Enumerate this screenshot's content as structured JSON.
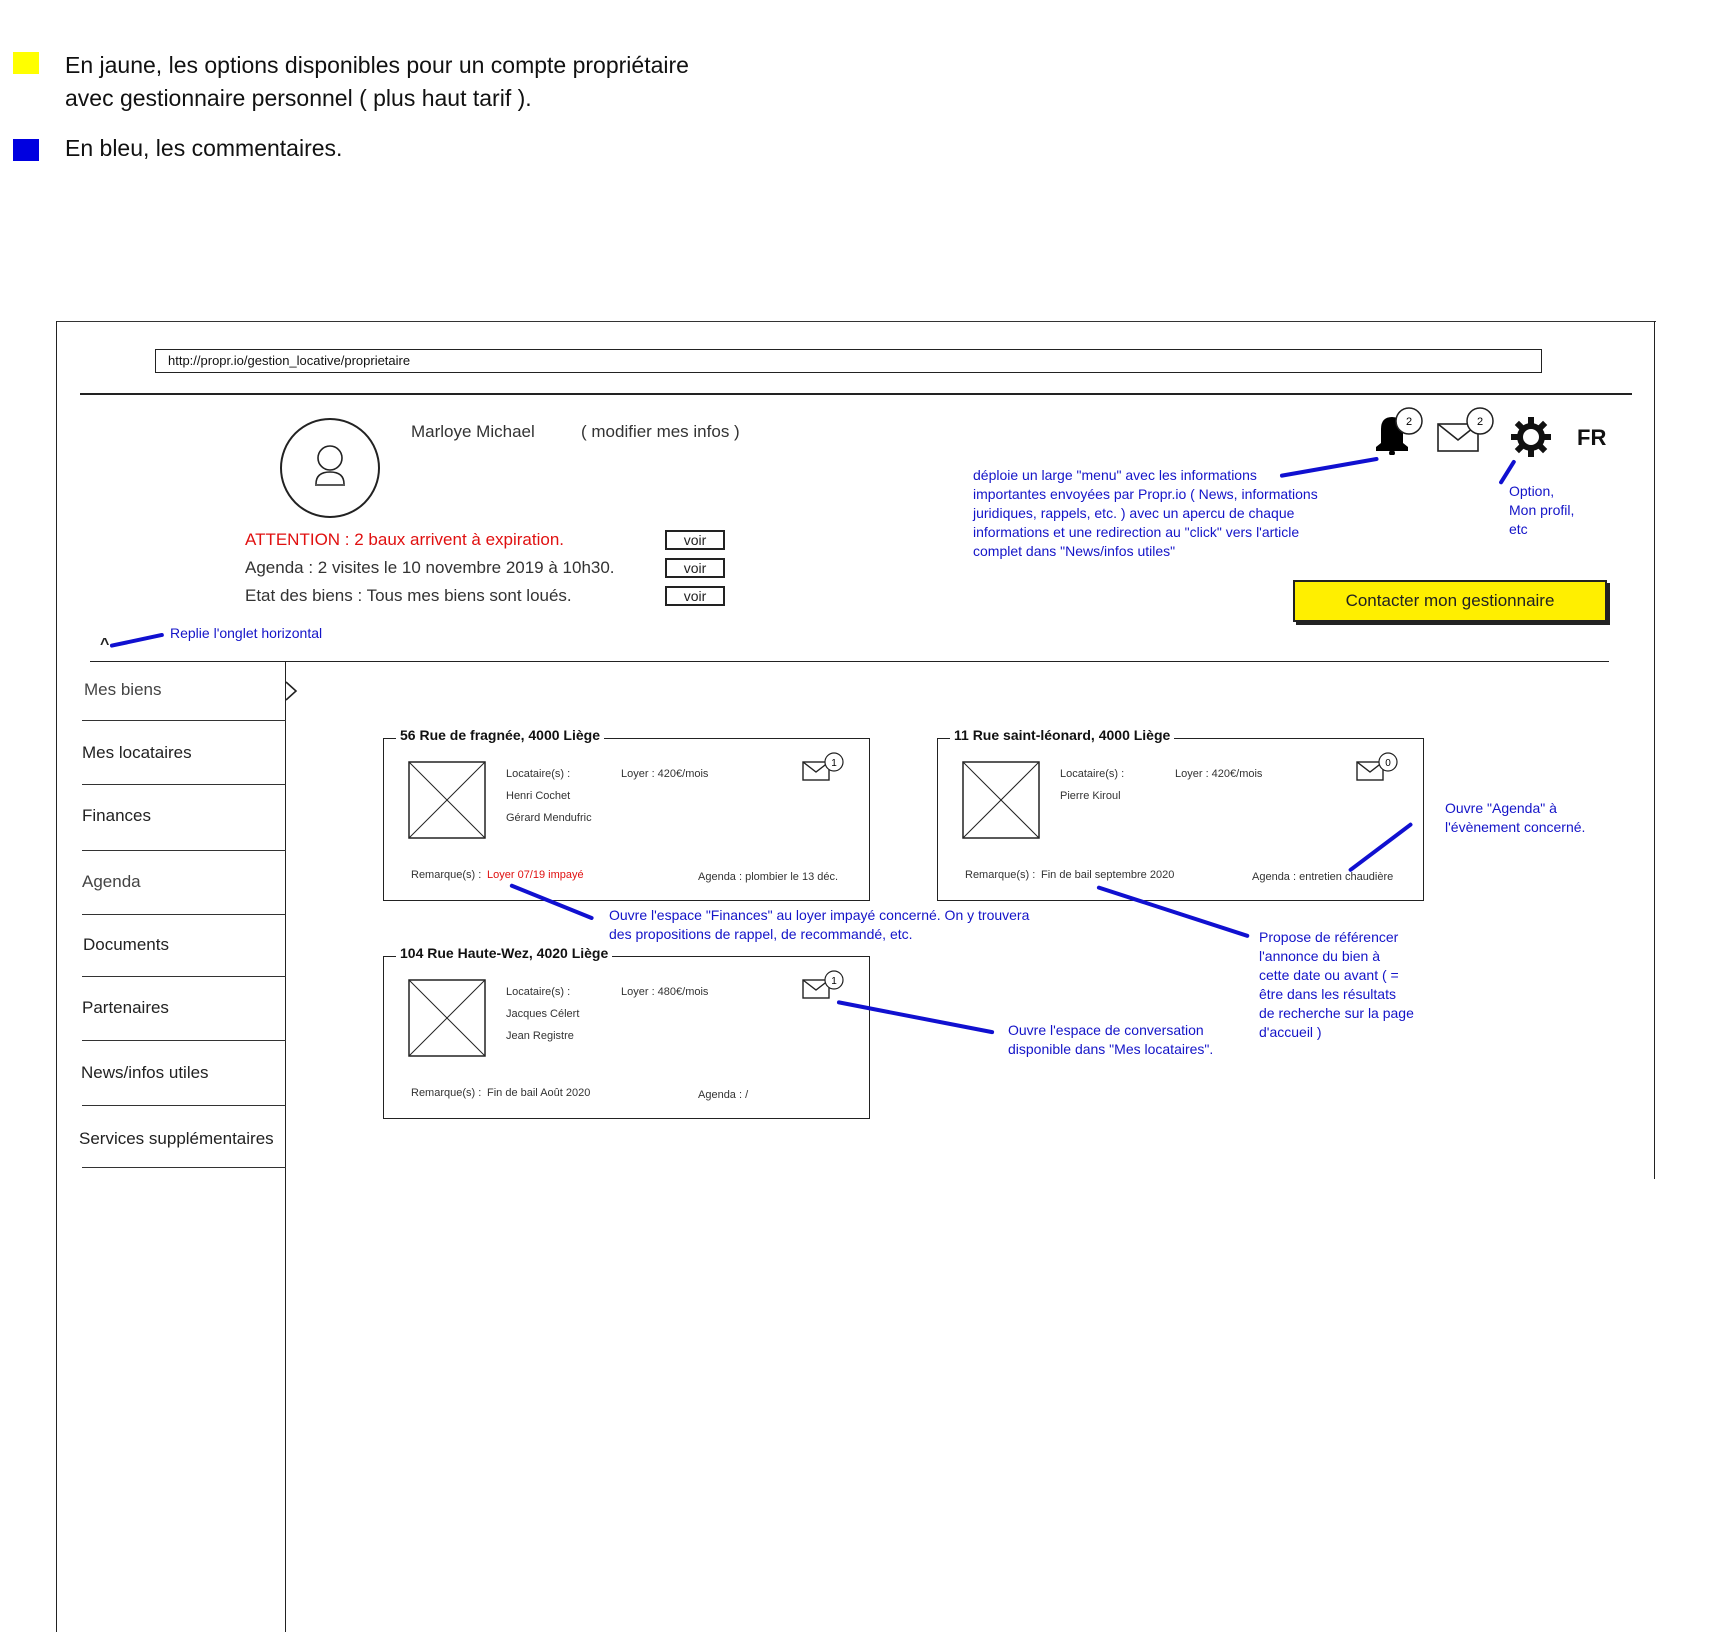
{
  "legend": {
    "yellow_color": "#ffff00",
    "blue_color": "#0000e0",
    "yellow_line1": "En jaune, les options disponibles pour un compte propriétaire",
    "yellow_line2": "avec gestionnaire personnel ( plus haut tarif ).",
    "blue_text": "En bleu, les commentaires."
  },
  "browser": {
    "url_prefix": "http://propr.io/",
    "url_path": "gestion_locative/proprietaire"
  },
  "profile": {
    "name": "Marloye Michael",
    "edit_link": "( modifier mes infos )"
  },
  "alerts": [
    {
      "text": "ATTENTION : 2 baux arrivent à expiration.",
      "button": "voir"
    },
    {
      "text": "Agenda : 2 visites le 10 novembre 2019 à 10h30.",
      "button": "voir"
    },
    {
      "text": "Etat des biens : Tous mes biens sont loués.",
      "button": "voir"
    }
  ],
  "header": {
    "notifications_count": "2",
    "messages_count": "2",
    "language": "FR",
    "contact_button": "Contacter mon gestionnaire"
  },
  "annotations": {
    "notifications": [
      "déploie un large \"menu\" avec les informations",
      "importantes envoyées par Propr.io ( News, informations",
      "juridiques, rappels, etc. ) avec un apercu de chaque",
      "informations et une redirection au \"click\" vers l'article",
      "complet dans \"News/infos utiles\""
    ],
    "settings": [
      "Option,",
      "Mon profil,",
      "etc"
    ],
    "collapse": "Replie l'onglet horizontal",
    "collapse_symbol": "^",
    "agenda": [
      "Ouvre \"Agenda\" à",
      "l'évènement concerné."
    ],
    "finances": [
      "Ouvre l'espace \"Finances\" au loyer impayé concerné. On y trouvera",
      "des propositions de rappel, de recommandé, etc."
    ],
    "listing": [
      "Propose de référencer",
      "l'annonce du bien à",
      "cette date ou avant ( =",
      "être dans les résultats",
      "de recherche sur la page",
      "d'accueil )"
    ],
    "conversation": [
      "Ouvre l'espace de conversation",
      "disponible dans \"Mes locataires\"."
    ]
  },
  "sidebar": {
    "items": [
      "Mes biens",
      "Mes locataires",
      "Finances",
      "Agenda",
      "Documents",
      "Partenaires",
      "News/infos utiles",
      "Services supplémentaires"
    ]
  },
  "properties": [
    {
      "address": "56 Rue de fragnée, 4000 Liège",
      "tenants_label": "Locataire(s) :",
      "tenants": [
        "Henri Cochet",
        "Gérard Mendufric"
      ],
      "rent": "Loyer : 420€/mois",
      "messages": "1",
      "remark_label": "Remarque(s) :",
      "remark": "Loyer 07/19 impayé",
      "agenda": "Agenda : plombier le 13 déc."
    },
    {
      "address": "11 Rue saint-léonard, 4000 Liège",
      "tenants_label": "Locataire(s) :",
      "tenants": [
        "Pierre Kiroul"
      ],
      "rent": "Loyer : 420€/mois",
      "messages": "0",
      "remark_label": "Remarque(s) :",
      "remark": "Fin de bail  septembre  2020",
      "agenda": "Agenda : entretien chaudière"
    },
    {
      "address": "104 Rue Haute-Wez, 4020 Liège",
      "tenants_label": "Locataire(s) :",
      "tenants": [
        "Jacques Célert",
        "Jean Registre"
      ],
      "rent": "Loyer : 480€/mois",
      "messages": "1",
      "remark_label": "Remarque(s) :",
      "remark": "Fin de bail  Août 2020",
      "agenda": "Agenda :  /"
    }
  ]
}
